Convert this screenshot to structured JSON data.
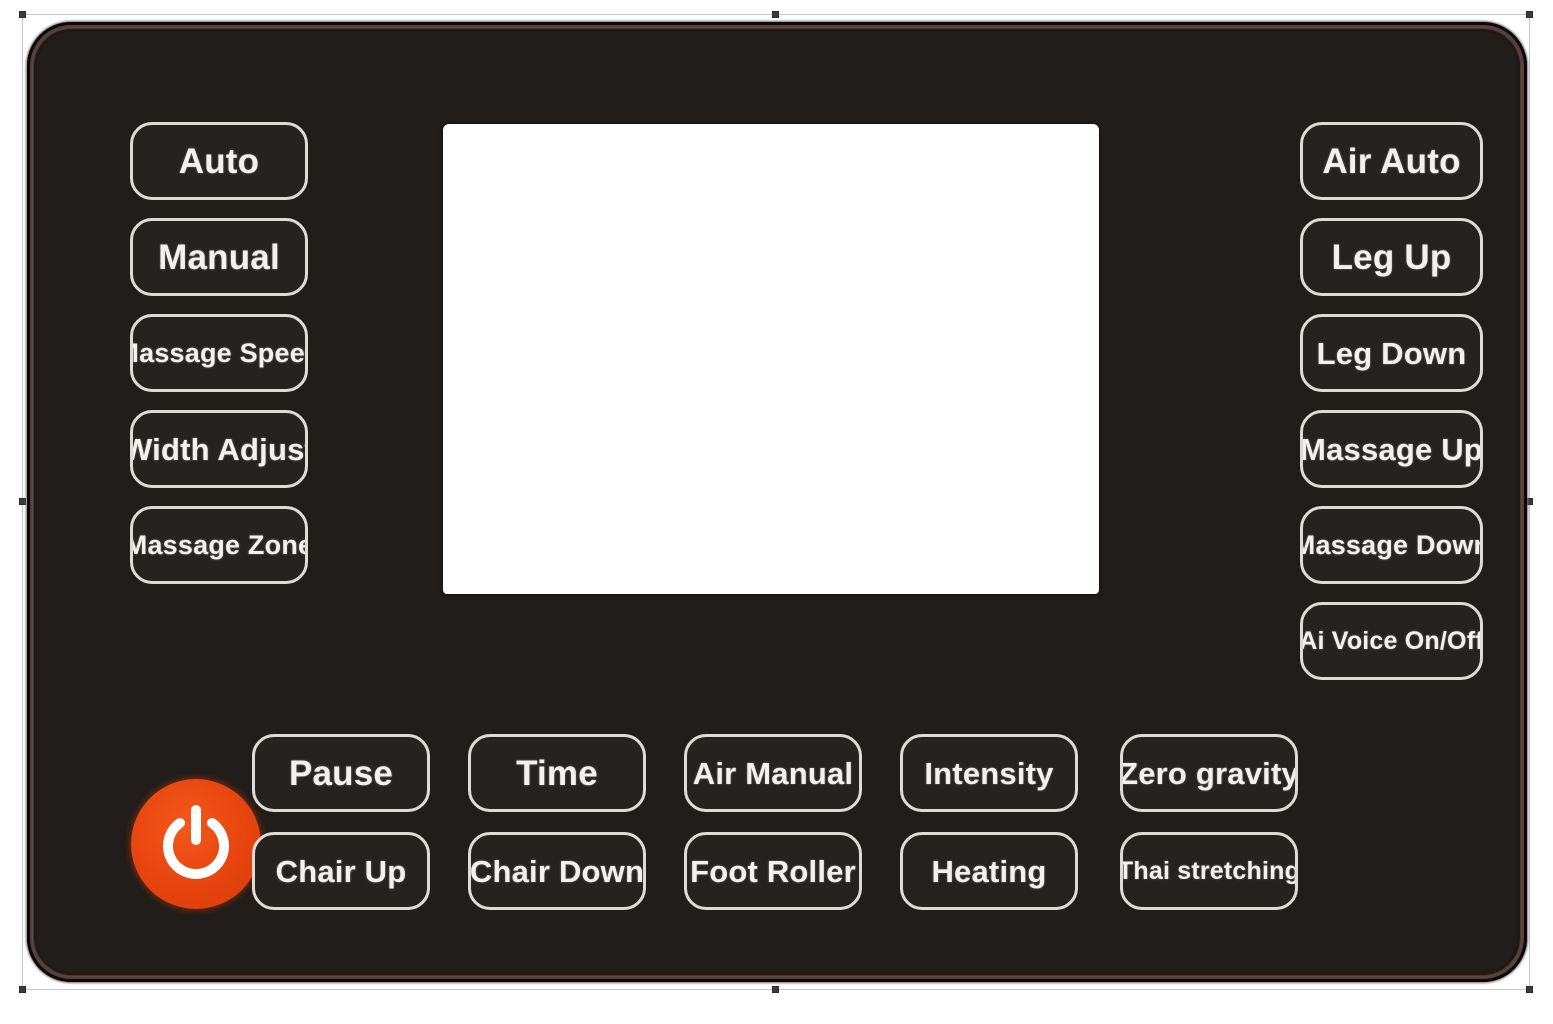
{
  "device": {
    "type": "massage-chair-remote-control-panel",
    "body_color": "#211d1a",
    "accent_color": "#54403a",
    "button_border_color": "#dcdbd6",
    "button_text_color": "#f2f1ee",
    "power_button_color": "#e8450f",
    "display_color": "#ffffff"
  },
  "display": {
    "label": "LCD screen",
    "content": ""
  },
  "power": {
    "label": "Power",
    "icon": "power-icon"
  },
  "left_column": {
    "buttons": [
      {
        "label": "Auto",
        "size": "size-lg"
      },
      {
        "label": "Manual",
        "size": "size-lg"
      },
      {
        "label": "Massage Speed",
        "size": "size-sm"
      },
      {
        "label": "Width Adjust",
        "size": "size-md"
      },
      {
        "label": "Massage Zone",
        "size": "size-sm"
      }
    ]
  },
  "right_column": {
    "buttons": [
      {
        "label": "Air Auto",
        "size": "size-lg"
      },
      {
        "label": "Leg Up",
        "size": "size-lg"
      },
      {
        "label": "Leg Down",
        "size": "size-md"
      },
      {
        "label": "Massage Up",
        "size": "size-md"
      },
      {
        "label": "Massage Down",
        "size": "size-sm"
      },
      {
        "label": "Ai Voice On/Off",
        "size": "size-xs"
      }
    ]
  },
  "bottom_grid": {
    "row_one": [
      {
        "label": "Pause",
        "size": "size-lg"
      },
      {
        "label": "Time",
        "size": "size-lg"
      },
      {
        "label": "Air Manual",
        "size": "size-md"
      },
      {
        "label": "Intensity",
        "size": "size-md"
      },
      {
        "label": "Zero gravity",
        "size": "size-md"
      }
    ],
    "row_two": [
      {
        "label": "Chair Up",
        "size": "size-md"
      },
      {
        "label": "Chair Down",
        "size": "size-md"
      },
      {
        "label": "Foot Roller",
        "size": "size-md"
      },
      {
        "label": "Heating",
        "size": "size-md"
      },
      {
        "label": "Thai stretching",
        "size": "size-xs"
      }
    ]
  }
}
